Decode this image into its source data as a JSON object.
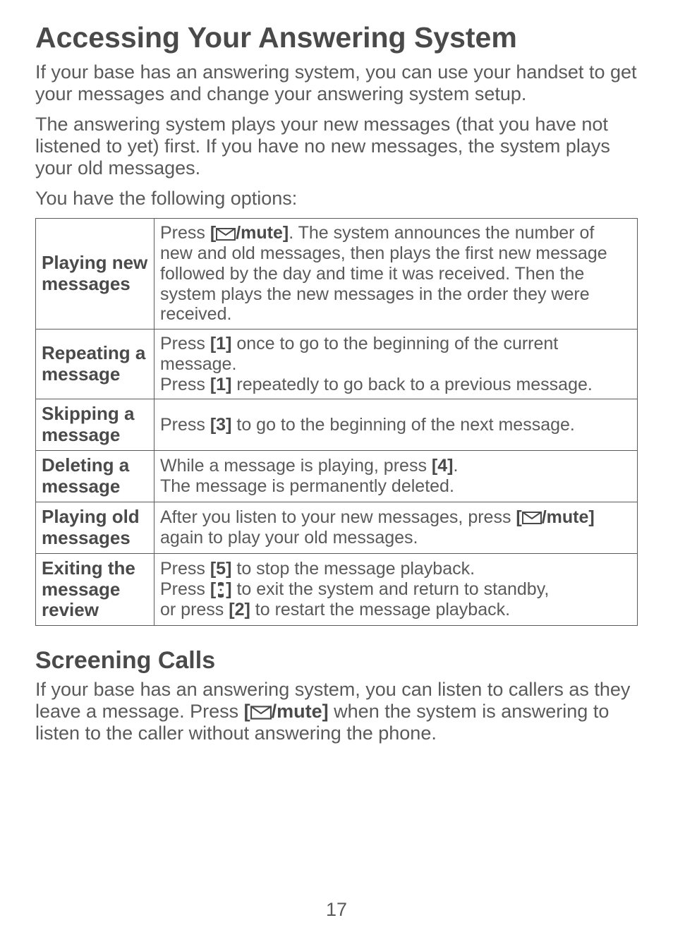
{
  "title": "Accessing Your Answering System",
  "intro1": "If your base has an answering system, you can use your handset to get your messages and change your answering system setup.",
  "intro2": "The answering system plays your new messages (that you have not listened to yet) first. If you have no new messages, the system plays your old messages.",
  "intro3": "You have the following options:",
  "table": {
    "r1": {
      "label": "Playing new messages",
      "pre": "Press ",
      "key": "/mute]",
      "post": ". The system announces the number of new and old messages, then plays the first new message followed by the day and time it was received. Then the system plays the new messages in the order they were received."
    },
    "r2": {
      "label": "Repeating a message",
      "line1_pre": "Press ",
      "line1_key": "[1]",
      "line1_post": " once to go to the beginning of the current message.",
      "line2_pre": "Press ",
      "line2_key": "[1]",
      "line2_post": " repeatedly to go back to a previous message."
    },
    "r3": {
      "label": "Skipping a message",
      "pre": "Press ",
      "key": "[3]",
      "post": " to go to the beginning of the next message."
    },
    "r4": {
      "label": "Deleting a message",
      "line1_pre": "While a message is playing, press ",
      "line1_key": "[4]",
      "line1_post": ".",
      "line2": "The message is permanently deleted."
    },
    "r5": {
      "label": "Playing old messages",
      "pre": "After you listen to your new messages, press ",
      "key": "/mute]",
      "post": " again to play your old messages."
    },
    "r6": {
      "label": "Exiting the message review",
      "line1_pre": "Press ",
      "line1_key": "[5]",
      "line1_post": " to stop the message playback.",
      "line2_pre": "Press ",
      "line2_key_open": "[",
      "line2_key_close": "]",
      "line2_post": " to exit the system and return to standby,",
      "line3_pre": "or press ",
      "line3_key": "[2]",
      "line3_post": " to restart the message playback."
    }
  },
  "section2_title": "Screening Calls",
  "section2_pre": "If your base has an answering system, you can listen to callers as they leave a message. Press ",
  "section2_key": "/mute]",
  "section2_post": " when the system is answering to listen to the caller without answering the phone.",
  "page_num": "17",
  "bracket_open": "["
}
